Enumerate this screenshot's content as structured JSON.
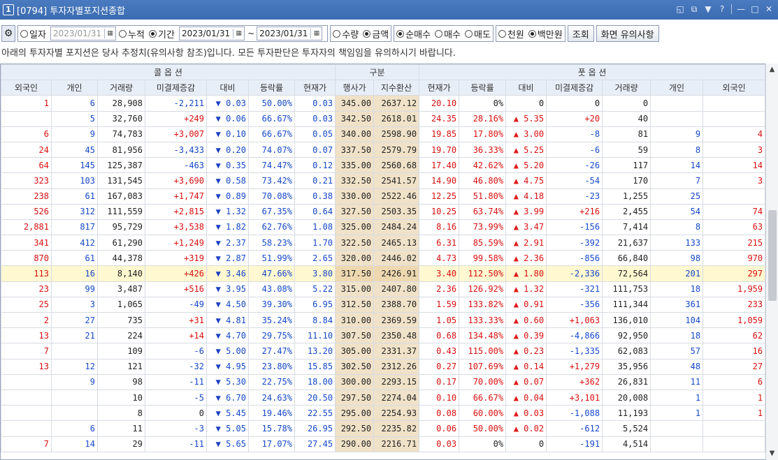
{
  "window": {
    "num": "1",
    "title": "[0794] 투자자별포지션종합",
    "controls": [
      "◱",
      "⧉",
      "▼",
      "?",
      "—",
      "□",
      "✕"
    ]
  },
  "toolbar": {
    "opt_day": "일자",
    "date_day": "2023/01/31",
    "opt_cum": "누적",
    "opt_period": "기간",
    "date_from": "2023/01/31",
    "tilde": "~",
    "date_to": "2023/01/31",
    "opt_qty": "수량",
    "opt_amt": "금액",
    "opt_netbuy": "순매수",
    "opt_buy": "매수",
    "opt_sell": "매도",
    "opt_thousand": "천원",
    "opt_million": "백만원",
    "btn_query": "조회",
    "btn_note": "화면 유의사항",
    "gear_icon": "⚙",
    "cal_icon": "▦"
  },
  "notice": "아래의 투자자별 포지션은 당사 추정치(유의사항 참조)입니다. 모든 투자판단은 투자자의 책임임을 유의하시기 바랍니다.",
  "headers": {
    "call": "콜 옵 션",
    "mid": "구분",
    "put": "풋 옵 션",
    "cols": [
      "외국인",
      "개인",
      "거래량",
      "미결제증감",
      "대비",
      "등락률",
      "현재가",
      "행사가",
      "지수환산",
      "현재가",
      "등락률",
      "대비",
      "미결제증감",
      "거래량",
      "개인",
      "외국인"
    ]
  },
  "rows": [
    [
      "1",
      "6",
      "28,908",
      "-2,211",
      "0.03",
      "50.00%",
      "0.03",
      "345.00",
      "2637.12",
      "20.10",
      "0%",
      "0",
      "0",
      "0",
      "",
      ""
    ],
    [
      "",
      "5",
      "32,760",
      "+249",
      "0.06",
      "66.67%",
      "0.03",
      "342.50",
      "2618.01",
      "24.35",
      "28.16%",
      "5.35",
      "+20",
      "40",
      "",
      ""
    ],
    [
      "6",
      "9",
      "74,783",
      "+3,007",
      "0.10",
      "66.67%",
      "0.05",
      "340.00",
      "2598.90",
      "19.85",
      "17.80%",
      "3.00",
      "-8",
      "81",
      "9",
      "4"
    ],
    [
      "24",
      "45",
      "81,956",
      "-3,433",
      "0.20",
      "74.07%",
      "0.07",
      "337.50",
      "2579.79",
      "19.70",
      "36.33%",
      "5.25",
      "-6",
      "59",
      "8",
      "3"
    ],
    [
      "64",
      "145",
      "125,387",
      "-463",
      "0.35",
      "74.47%",
      "0.12",
      "335.00",
      "2560.68",
      "17.40",
      "42.62%",
      "5.20",
      "-26",
      "117",
      "14",
      "14"
    ],
    [
      "323",
      "103",
      "131,545",
      "+3,690",
      "0.58",
      "73.42%",
      "0.21",
      "332.50",
      "2541.57",
      "14.90",
      "46.80%",
      "4.75",
      "-54",
      "170",
      "7",
      "3"
    ],
    [
      "238",
      "61",
      "167,083",
      "+1,747",
      "0.89",
      "70.08%",
      "0.38",
      "330.00",
      "2522.46",
      "12.25",
      "51.80%",
      "4.18",
      "-23",
      "1,255",
      "25",
      ""
    ],
    [
      "526",
      "312",
      "111,559",
      "+2,815",
      "1.32",
      "67.35%",
      "0.64",
      "327.50",
      "2503.35",
      "10.25",
      "63.74%",
      "3.99",
      "+216",
      "2,455",
      "54",
      "74"
    ],
    [
      "2,881",
      "817",
      "95,729",
      "+3,538",
      "1.82",
      "62.76%",
      "1.08",
      "325.00",
      "2484.24",
      "8.16",
      "73.99%",
      "3.47",
      "-156",
      "7,414",
      "8",
      "63"
    ],
    [
      "341",
      "412",
      "61,290",
      "+1,249",
      "2.37",
      "58.23%",
      "1.70",
      "322.50",
      "2465.13",
      "6.31",
      "85.59%",
      "2.91",
      "-392",
      "21,637",
      "133",
      "215"
    ],
    [
      "870",
      "61",
      "44,378",
      "+319",
      "2.87",
      "51.99%",
      "2.65",
      "320.00",
      "2446.02",
      "4.73",
      "99.58%",
      "2.36",
      "-856",
      "66,840",
      "98",
      "970"
    ],
    [
      "113",
      "16",
      "8,140",
      "+426",
      "3.46",
      "47.66%",
      "3.80",
      "317.50",
      "2426.91",
      "3.40",
      "112.50%",
      "1.80",
      "-2,336",
      "72,564",
      "201",
      "297"
    ],
    [
      "23",
      "99",
      "3,487",
      "+516",
      "3.95",
      "43.08%",
      "5.22",
      "315.00",
      "2407.80",
      "2.36",
      "126.92%",
      "1.32",
      "-321",
      "111,753",
      "18",
      "1,959"
    ],
    [
      "25",
      "3",
      "1,065",
      "-49",
      "4.50",
      "39.30%",
      "6.95",
      "312.50",
      "2388.70",
      "1.59",
      "133.82%",
      "0.91",
      "-356",
      "111,344",
      "361",
      "233"
    ],
    [
      "2",
      "27",
      "735",
      "+31",
      "4.81",
      "35.24%",
      "8.84",
      "310.00",
      "2369.59",
      "1.05",
      "133.33%",
      "0.60",
      "+1,063",
      "136,010",
      "104",
      "1,059"
    ],
    [
      "13",
      "21",
      "224",
      "+14",
      "4.70",
      "29.75%",
      "11.10",
      "307.50",
      "2350.48",
      "0.68",
      "134.48%",
      "0.39",
      "-4,866",
      "92,950",
      "18",
      "62"
    ],
    [
      "7",
      "",
      "109",
      "-6",
      "5.00",
      "27.47%",
      "13.20",
      "305.00",
      "2331.37",
      "0.43",
      "115.00%",
      "0.23",
      "-1,335",
      "62,083",
      "57",
      "16"
    ],
    [
      "13",
      "12",
      "121",
      "-32",
      "4.95",
      "23.80%",
      "15.85",
      "302.50",
      "2312.26",
      "0.27",
      "107.69%",
      "0.14",
      "+1,279",
      "35,956",
      "48",
      "27"
    ],
    [
      "",
      "9",
      "98",
      "-11",
      "5.30",
      "22.75%",
      "18.00",
      "300.00",
      "2293.15",
      "0.17",
      "70.00%",
      "0.07",
      "+362",
      "26,831",
      "11",
      "6"
    ],
    [
      "",
      "",
      "10",
      "-5",
      "6.70",
      "24.63%",
      "20.50",
      "297.50",
      "2274.04",
      "0.10",
      "66.67%",
      "0.04",
      "+3,101",
      "20,008",
      "1",
      "1"
    ],
    [
      "",
      "",
      "8",
      "0",
      "5.45",
      "19.46%",
      "22.55",
      "295.00",
      "2254.93",
      "0.08",
      "60.00%",
      "0.03",
      "-1,088",
      "11,193",
      "1",
      "1"
    ],
    [
      "",
      "6",
      "11",
      "-3",
      "5.05",
      "15.78%",
      "26.95",
      "292.50",
      "2235.82",
      "0.06",
      "50.00%",
      "0.02",
      "-612",
      "5,524",
      "",
      ""
    ],
    [
      "7",
      "14",
      "29",
      "-11",
      "5.65",
      "17.07%",
      "27.45",
      "290.00",
      "2216.71",
      "0.03",
      "0%",
      "0",
      "-191",
      "4,514",
      "",
      ""
    ]
  ],
  "highlight_row": 11,
  "colors": {
    "red": "#d81010",
    "blue": "#1548c8",
    "mid_bg": "#f0e2c8",
    "highlight": "#fff8d0",
    "title_bg": "#3b6bb0"
  }
}
